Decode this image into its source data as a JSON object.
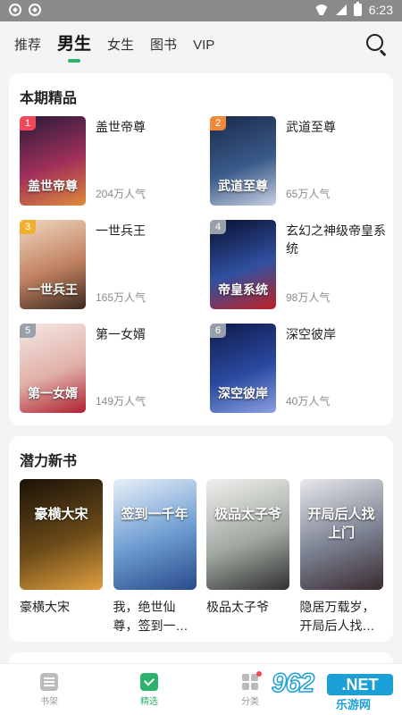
{
  "status_bar": {
    "time": "6:23"
  },
  "top_nav": {
    "tabs": [
      {
        "label": "推荐"
      },
      {
        "label": "男生"
      },
      {
        "label": "女生"
      },
      {
        "label": "图书"
      },
      {
        "label": "VIP"
      }
    ],
    "active_tab": "男生",
    "icons": {
      "search": "search-icon"
    }
  },
  "featured": {
    "title": "本期精品",
    "items": [
      {
        "rank": "1",
        "name": "盖世帝尊",
        "popularity": "204万人气",
        "cover_text": "盖世帝尊",
        "rank_color": "#f04a5a",
        "cover_colors": [
          "#2a1a3a",
          "#a0305a",
          "#e08a3a"
        ]
      },
      {
        "rank": "2",
        "name": "武道至尊",
        "popularity": "65万人气",
        "cover_text": "武道至尊",
        "rank_color": "#f08a3a",
        "cover_colors": [
          "#1a2a4a",
          "#3a5a8a",
          "#c8d0e0"
        ]
      },
      {
        "rank": "3",
        "name": "一世兵王",
        "popularity": "165万人气",
        "cover_text": "一世兵王",
        "rank_color": "#f0b030",
        "cover_colors": [
          "#f0d8c0",
          "#c08060",
          "#3a2a20"
        ]
      },
      {
        "rank": "4",
        "name": "玄幻之神级帝皇系统",
        "popularity": "98万人气",
        "cover_text": "帝皇系统",
        "rank_color": "#9aa0aa",
        "cover_colors": [
          "#0a1030",
          "#3050a0",
          "#c02020"
        ]
      },
      {
        "rank": "5",
        "name": "第一女婿",
        "popularity": "149万人气",
        "cover_text": "第一女婿",
        "rank_color": "#9aa0aa",
        "cover_colors": [
          "#f4e8e4",
          "#e0b0a8",
          "#b02030"
        ]
      },
      {
        "rank": "6",
        "name": "深空彼岸",
        "popularity": "40万人气",
        "cover_text": "深空彼岸",
        "rank_color": "#9aa0aa",
        "cover_colors": [
          "#101a4a",
          "#2a4aa0",
          "#8aa0e0"
        ]
      }
    ]
  },
  "potential": {
    "title": "潜力新书",
    "items": [
      {
        "name": "豪横大宋",
        "cover_text": "豪横大宋",
        "cover_colors": [
          "#1a1208",
          "#6a4a18",
          "#e0a040"
        ]
      },
      {
        "name": "我，绝世仙尊，签到一…",
        "cover_text": "签到一千年",
        "cover_colors": [
          "#e8f0f8",
          "#6a9ad0",
          "#2a4a8a"
        ]
      },
      {
        "name": "极品太子爷",
        "cover_text": "极品太子爷",
        "cover_colors": [
          "#f0f0ee",
          "#a0a8a0",
          "#303030"
        ]
      },
      {
        "name": "隐居万载岁，开局后人找…",
        "cover_text": "开局后人找上门",
        "cover_colors": [
          "#e8e8ec",
          "#7a8090",
          "#3a2a30"
        ]
      }
    ]
  },
  "next_section_hint": "",
  "bottom_nav": {
    "items": [
      {
        "label": "书架",
        "icon": "bookshelf-icon"
      },
      {
        "label": "精选",
        "icon": "featured-icon"
      },
      {
        "label": "分类",
        "icon": "category-icon"
      }
    ]
  },
  "watermark": {
    "number": "962",
    "suffix": ".NET",
    "sub": "乐游网"
  }
}
